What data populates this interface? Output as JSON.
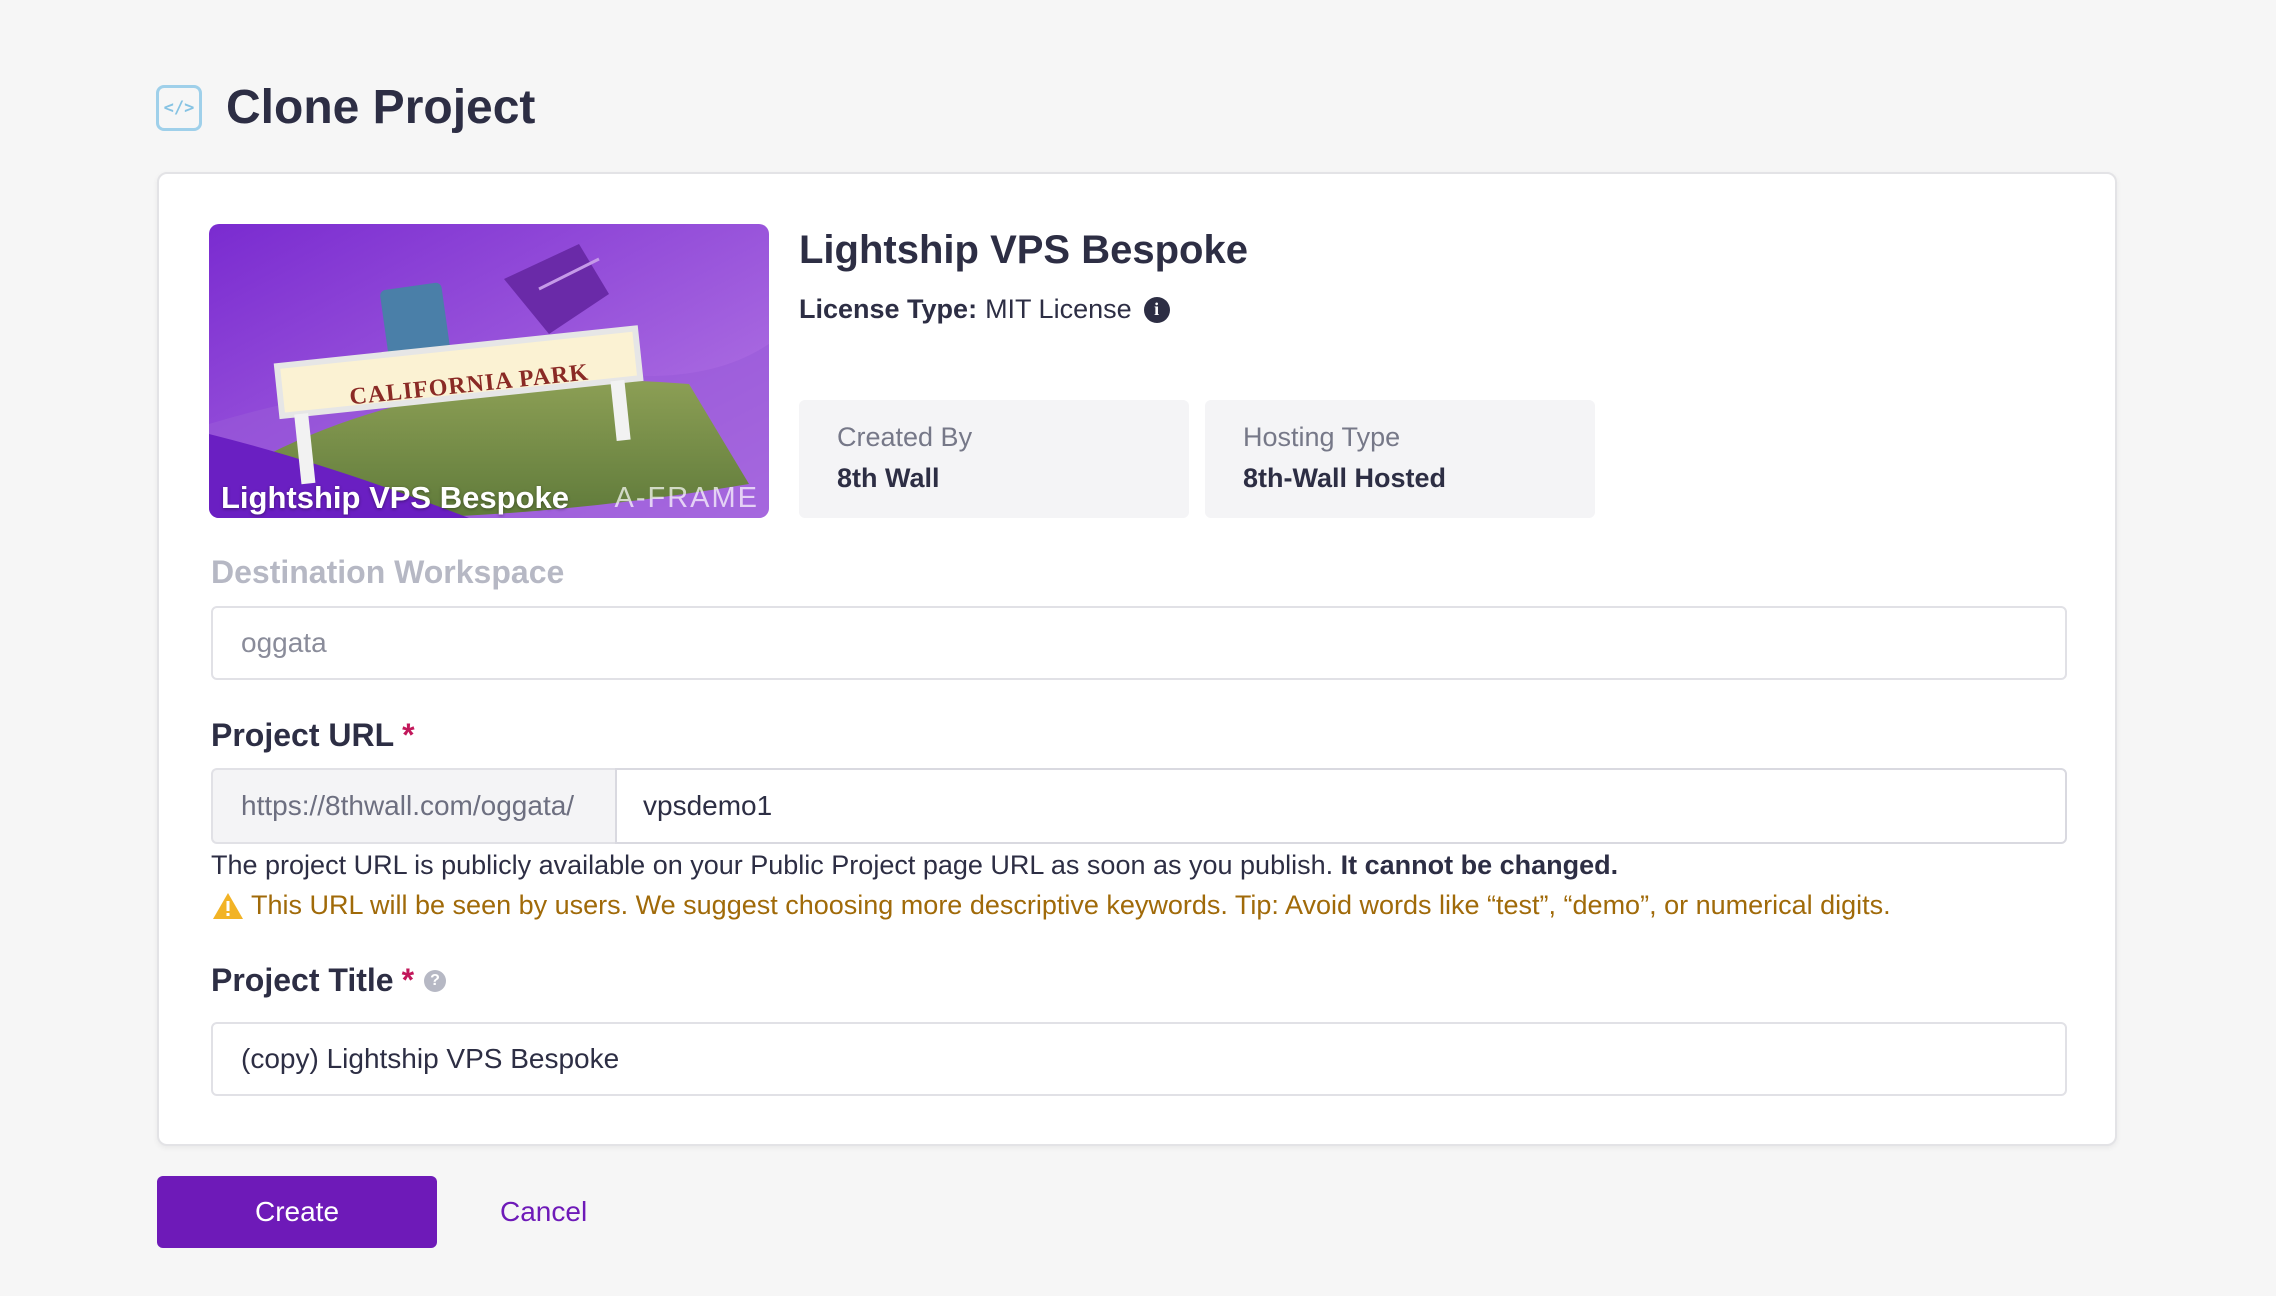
{
  "header": {
    "icon": "code-icon",
    "icon_glyph": "</>",
    "title": "Clone Project"
  },
  "project": {
    "thumbnail_title": "Lightship VPS Bespoke",
    "thumbnail_badge": "A-FRAME",
    "thumbnail_sign_text": "CALIFORNIA PARK",
    "name": "Lightship VPS Bespoke",
    "license_label": "License Type:",
    "license_value": "MIT License",
    "created_by_label": "Created By",
    "created_by_value": "8th Wall",
    "hosting_type_label": "Hosting Type",
    "hosting_type_value": "8th-Wall Hosted"
  },
  "form": {
    "destination_workspace": {
      "label": "Destination Workspace",
      "value": "oggata"
    },
    "project_url": {
      "label": "Project URL",
      "required_mark": "*",
      "prefix": "https://8thwall.com/oggata/",
      "value": "vpsdemo1",
      "help_text": "The project URL is publicly available on your Public Project page URL as soon as you publish.",
      "help_text_bold": "It cannot be changed.",
      "warning": "This URL will be seen by users. We suggest choosing more descriptive keywords. Tip: Avoid words like “test”, “demo”, or numerical digits."
    },
    "project_title": {
      "label": "Project Title",
      "required_mark": "*",
      "help_glyph": "?",
      "value": "(copy) Lightship VPS Bespoke"
    }
  },
  "actions": {
    "create_label": "Create",
    "cancel_label": "Cancel"
  },
  "colors": {
    "accent": "#6e1ab8",
    "required": "#c2185b",
    "warning": "#a06a09",
    "background": "#f6f6f6"
  }
}
